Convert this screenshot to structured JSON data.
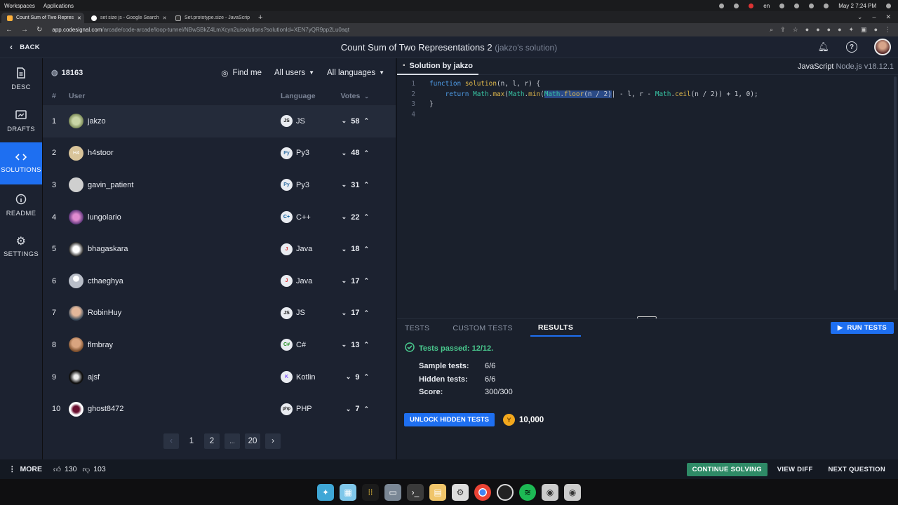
{
  "system": {
    "left": [
      "Workspaces",
      "Applications"
    ],
    "lang": "en",
    "datetime": "May 2   7:24 PM"
  },
  "browser": {
    "tabs": [
      {
        "title": "Count Sum of Two Repres",
        "active": true
      },
      {
        "title": "set size js - Google Search",
        "active": false
      },
      {
        "title": "Set.prototype.size - JavaScrip",
        "active": false
      }
    ],
    "url_host": "app.codesignal.com",
    "url_path": "/arcade/code-arcade/loop-tunnel/NBwSBkZ4LmXcyn2u/solutions?solutionId=XEN7yQR9pp2Lu0aqt"
  },
  "header": {
    "back": "BACK",
    "title": "Count Sum of Two Representations 2",
    "subtitle": "(jakzo's solution)"
  },
  "leftnav": [
    {
      "label": "DESC",
      "icon": "document-icon"
    },
    {
      "label": "DRAFTS",
      "icon": "drafts-icon"
    },
    {
      "label": "SOLUTIONS",
      "icon": "code-icon",
      "active": true
    },
    {
      "label": "README",
      "icon": "info-icon"
    },
    {
      "label": "SETTINGS",
      "icon": "gear-icon"
    }
  ],
  "solutions": {
    "count": "18163",
    "find_me": "Find me",
    "filter_users": "All users",
    "filter_languages": "All languages",
    "columns": {
      "rank": "#",
      "user": "User",
      "language": "Language",
      "votes": "Votes"
    },
    "rows": [
      {
        "rank": "1",
        "user": "jakzo",
        "lang_icon": "JS",
        "lang": "JS",
        "votes": "58",
        "up_active": true
      },
      {
        "rank": "2",
        "user": "h4stoor",
        "lang_icon": "Py",
        "lang": "Py3",
        "votes": "48",
        "up_active": true
      },
      {
        "rank": "3",
        "user": "gavin_patient",
        "lang_icon": "Py",
        "lang": "Py3",
        "votes": "31",
        "up_active": true
      },
      {
        "rank": "4",
        "user": "lungolario",
        "lang_icon": "C+",
        "lang": "C++",
        "votes": "22",
        "up_active": true
      },
      {
        "rank": "5",
        "user": "bhagaskara",
        "lang_icon": "J",
        "lang": "Java",
        "votes": "18",
        "up_active": true
      },
      {
        "rank": "6",
        "user": "cthaeghya",
        "lang_icon": "J",
        "lang": "Java",
        "votes": "17",
        "up_active": true
      },
      {
        "rank": "7",
        "user": "RobinHuy",
        "lang_icon": "JS",
        "lang": "JS",
        "votes": "17",
        "up_active": true
      },
      {
        "rank": "8",
        "user": "flmbray",
        "lang_icon": "C#",
        "lang": "C#",
        "votes": "13",
        "up_active": true
      },
      {
        "rank": "9",
        "user": "ajsf",
        "lang_icon": "K",
        "lang": "Kotlin",
        "votes": "9",
        "up_active": true
      },
      {
        "rank": "10",
        "user": "ghost8472",
        "lang_icon": "php",
        "lang": "PHP",
        "votes": "7",
        "up_active": true
      }
    ],
    "pagination": {
      "prev": "‹",
      "pages": [
        "1",
        "2",
        "...",
        "20"
      ],
      "current": "1",
      "next": "›"
    }
  },
  "editor": {
    "tab_label": "Solution by jakzo",
    "language": "JavaScript",
    "runtime": "Node.js v18.12.1",
    "line_numbers": [
      "1",
      "2",
      "3",
      "4"
    ]
  },
  "results": {
    "tabs": [
      "TESTS",
      "CUSTOM TESTS",
      "RESULTS"
    ],
    "active_tab": "RESULTS",
    "run_tests": "RUN TESTS",
    "passed": "Tests passed: 12/12.",
    "stats": [
      {
        "label": "Sample tests:",
        "value": "6/6"
      },
      {
        "label": "Hidden tests:",
        "value": "6/6"
      },
      {
        "label": "Score:",
        "value": "300/300"
      }
    ],
    "unlock": "UNLOCK HIDDEN TESTS",
    "coins": "10,000"
  },
  "footer": {
    "more": "MORE",
    "likes": "130",
    "dislikes": "103",
    "continue": "CONTINUE SOLVING",
    "view_diff": "VIEW DIFF",
    "next_question": "NEXT QUESTION"
  },
  "colors": {
    "accent": "#1e6ff1",
    "success": "#49c98e",
    "continue_btn": "#2e8a66",
    "panel": "#1c2230"
  }
}
